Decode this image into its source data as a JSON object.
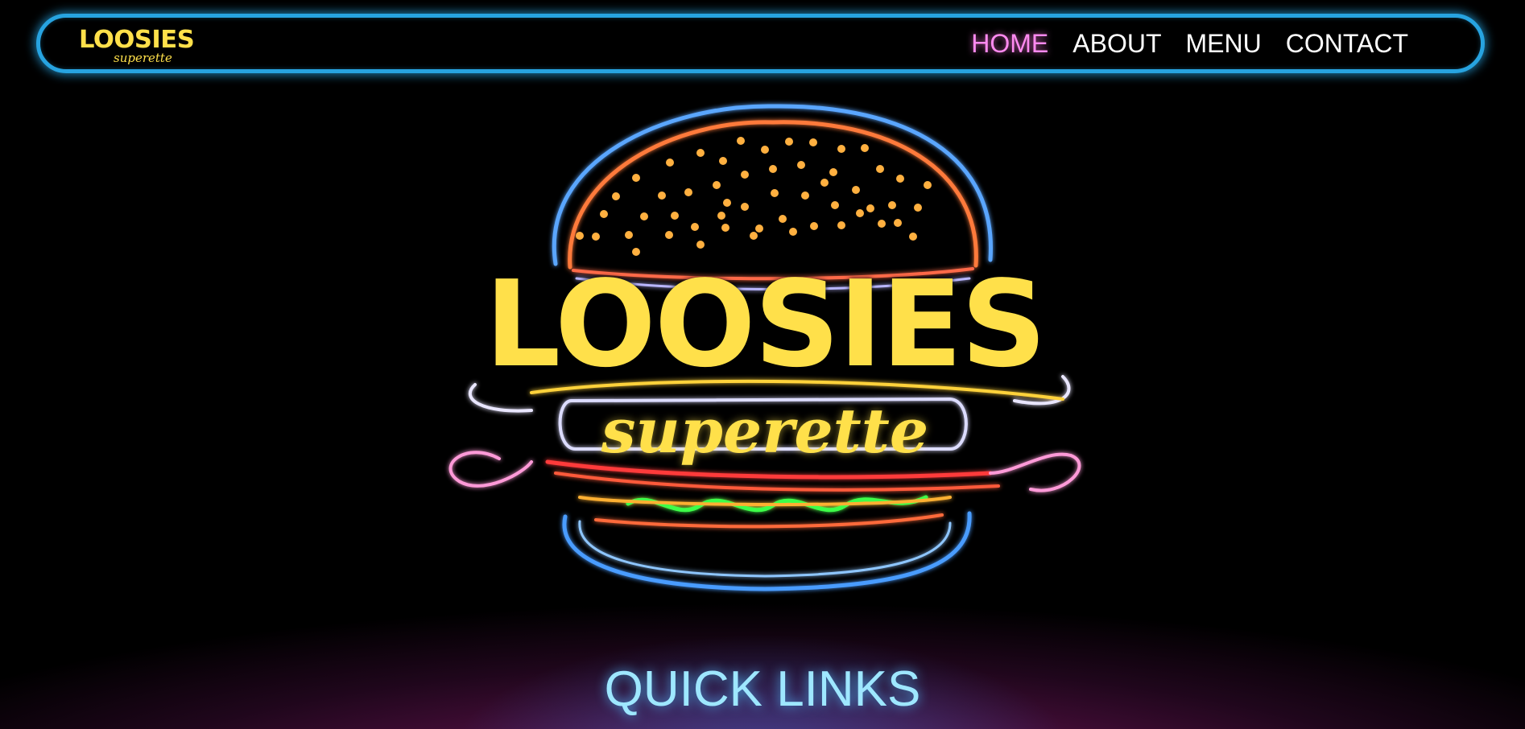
{
  "nav": {
    "logo_main": "LOOSIES",
    "logo_sub": "superette",
    "links": [
      {
        "label": "HOME",
        "active": true
      },
      {
        "label": "ABOUT",
        "active": false
      },
      {
        "label": "MENU",
        "active": false
      },
      {
        "label": "CONTACT",
        "active": false
      }
    ]
  },
  "hero": {
    "title": "LOOSIES",
    "subtitle": "superette",
    "image": "neon-burger-sign"
  },
  "section": {
    "quick_links_heading": "QUICK LINKS"
  },
  "colors": {
    "nav_border": "#27a3e0",
    "logo_yellow": "#ffe04a",
    "active_link": "#ff8af0",
    "heading_glow": "#9ee7ff",
    "bottom_glow": "#961c76"
  }
}
